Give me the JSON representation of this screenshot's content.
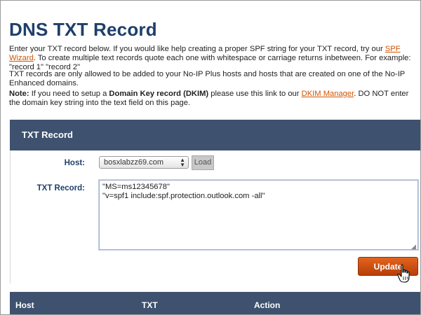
{
  "page": {
    "title": "DNS TXT Record",
    "intro": {
      "text_a": "Enter your TXT record below. If you would like help creating a proper SPF string for your TXT record, try our ",
      "link": "SPF Wizard",
      "text_b": ". To create multiple text records quote each one with whitespace or carriage returns inbetween. For example: \"record 1\" \"record 2\""
    },
    "restriction": "TXT records are only allowed to be added to your No-IP Plus hosts and hosts that are created on one of the No-IP Enhanced domains.",
    "note": {
      "label": "Note:",
      "text_a": " If you need to setup a ",
      "bold": "Domain Key record (DKIM)",
      "text_b": " please use this link to our ",
      "link": "DKIM Manager",
      "text_c": ". DO NOT enter the domain key string into the text field on this page."
    }
  },
  "panel": {
    "title": "TXT Record",
    "host_label": "Host:",
    "host_value": "bosxlabzz69.com",
    "load_label": "Load",
    "txt_label": "TXT Record:",
    "txt_value": "\"MS=ms12345678\"\n\"v=spf1 include:spf.protection.outlook.com -all\"",
    "update_label": "Update"
  },
  "table": {
    "headers": [
      "Host",
      "TXT",
      "Action"
    ]
  },
  "colors": {
    "title": "#1f3f6a",
    "header_bg": "#3e526f",
    "link": "#d35400",
    "update_button": "#d2541a"
  }
}
